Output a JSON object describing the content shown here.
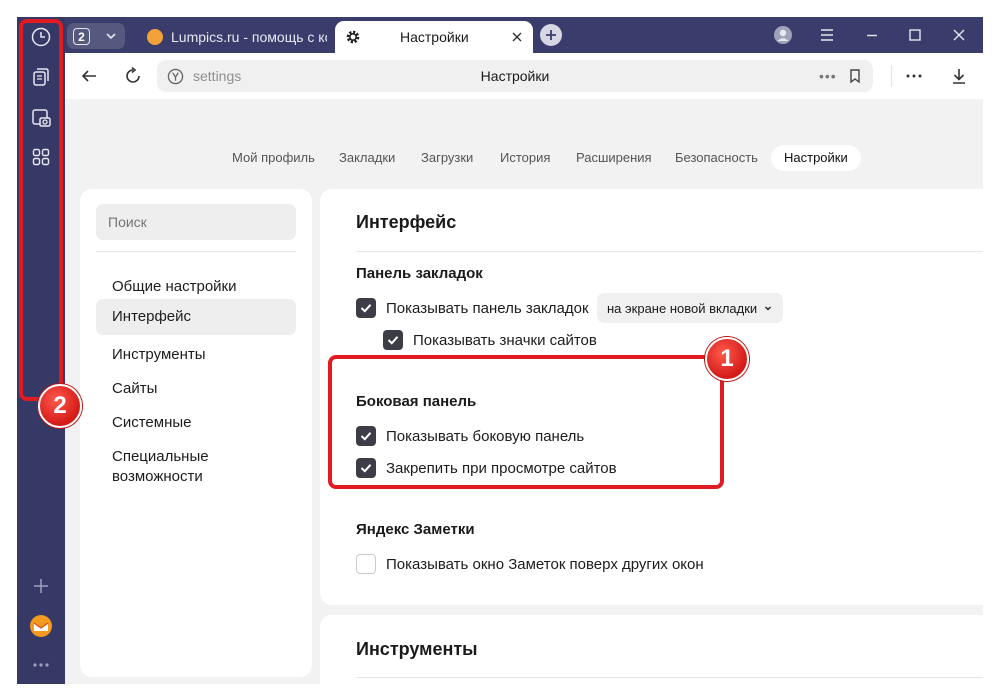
{
  "browser": {
    "tab_count": "2",
    "tabs": [
      {
        "label": "Lumpics.ru - помощь с компьютером"
      },
      {
        "label": "Настройки"
      }
    ]
  },
  "address_bar": {
    "url": "settings",
    "page_title": "Настройки",
    "more_label": "•••"
  },
  "settings_tabs": [
    {
      "label": "Мой профиль"
    },
    {
      "label": "Закладки"
    },
    {
      "label": "Загрузки"
    },
    {
      "label": "История"
    },
    {
      "label": "Расширения"
    },
    {
      "label": "Безопасность"
    },
    {
      "label": "Настройки",
      "active": true
    }
  ],
  "left_menu": {
    "search_placeholder": "Поиск",
    "items": [
      {
        "label": "Общие настройки"
      },
      {
        "label": "Интерфейс",
        "active": true
      },
      {
        "label": "Инструменты"
      },
      {
        "label": "Сайты"
      },
      {
        "label": "Системные"
      },
      {
        "label": "Специальные возможности"
      }
    ]
  },
  "interface": {
    "title": "Интерфейс",
    "bookmarks_panel": {
      "title": "Панель закладок",
      "show_panel_label": "Показывать панель закладок",
      "show_panel_checked": true,
      "select_value": "на экране новой вкладки",
      "show_icons_label": "Показывать значки сайтов",
      "show_icons_checked": true
    },
    "side_panel": {
      "title": "Боковая панель",
      "show_label": "Показывать боковую панель",
      "show_checked": true,
      "pin_label": "Закрепить при просмотре сайтов",
      "pin_checked": true
    },
    "notes": {
      "title": "Яндекс Заметки",
      "show_label": "Показывать окно Заметок поверх других окон",
      "show_checked": false
    }
  },
  "tools": {
    "title": "Инструменты"
  },
  "annotations": {
    "badge_1": "1",
    "badge_2": "2",
    "highlight_color": "#e11b22"
  },
  "colors": {
    "browser_frame": "#3a3d6b",
    "checkbox_on": "#3d3d47"
  }
}
